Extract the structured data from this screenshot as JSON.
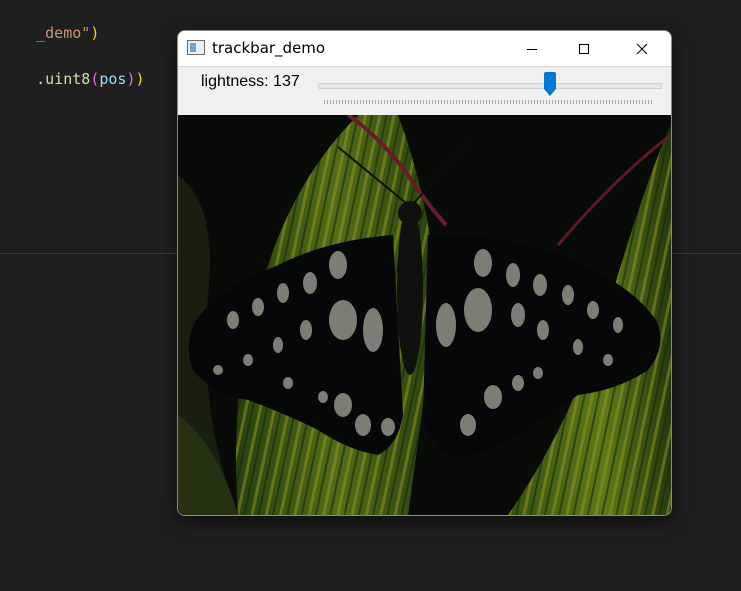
{
  "editor": {
    "line1": {
      "str": "_demo\"",
      "close": ")"
    },
    "line2": {
      "dot": ".",
      "fn": "uint8",
      "open": "(",
      "var": "pos",
      "close1": ")",
      "close2": ")"
    }
  },
  "window": {
    "title": "trackbar_demo",
    "icon": "window-app-icon",
    "controls": {
      "minimize": "minimize-icon",
      "maximize": "maximize-icon",
      "close": "close-icon"
    }
  },
  "trackbar": {
    "label": "lightness: 137",
    "value": 137,
    "min": 0,
    "max": 200,
    "accent_color": "#0078d7"
  },
  "image": {
    "subject": "butterfly-image"
  }
}
